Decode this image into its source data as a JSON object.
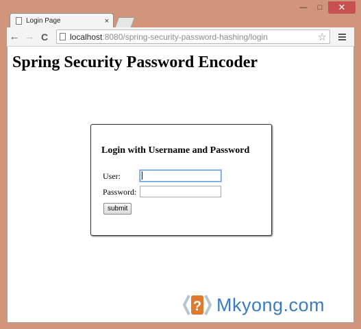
{
  "browser": {
    "tab_title": "Login Page",
    "tab_close_glyph": "×",
    "url_host": "localhost",
    "url_rest": ":8080/spring-security-password-hashing/login",
    "window_controls": {
      "minimize": "—",
      "maximize": "□",
      "close": "✕"
    },
    "nav": {
      "back": "←",
      "forward": "→",
      "reload": "C"
    },
    "star_glyph": "☆"
  },
  "page": {
    "title": "Spring Security Password Encoder",
    "login": {
      "heading": "Login with Username and Password",
      "user_label": "User:",
      "user_value": "",
      "password_label": "Password:",
      "password_value": "",
      "submit_label": "submit"
    }
  },
  "watermark": {
    "text": "Mkyong.com"
  },
  "colors": {
    "frame": "#d0957b",
    "close_button": "#c75050",
    "watermark": "#3a7cc1",
    "watermark_icon": "#e07a2e"
  }
}
